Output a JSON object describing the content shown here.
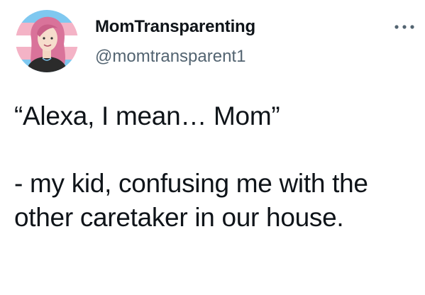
{
  "tweet": {
    "display_name": "MomTransparenting",
    "handle": "@momtransparent1",
    "more_icon": "more-options-icon",
    "quote": "“Alexa, I mean… Mom”",
    "caption": "- my kid, confusing me with the other caretaker in our house."
  },
  "colors": {
    "text": "#0f1419",
    "secondary_text": "#536471",
    "avatar_flag_blue": "#7fc8f0",
    "avatar_flag_pink": "#f4b3c6",
    "avatar_hair": "#d9739a"
  }
}
